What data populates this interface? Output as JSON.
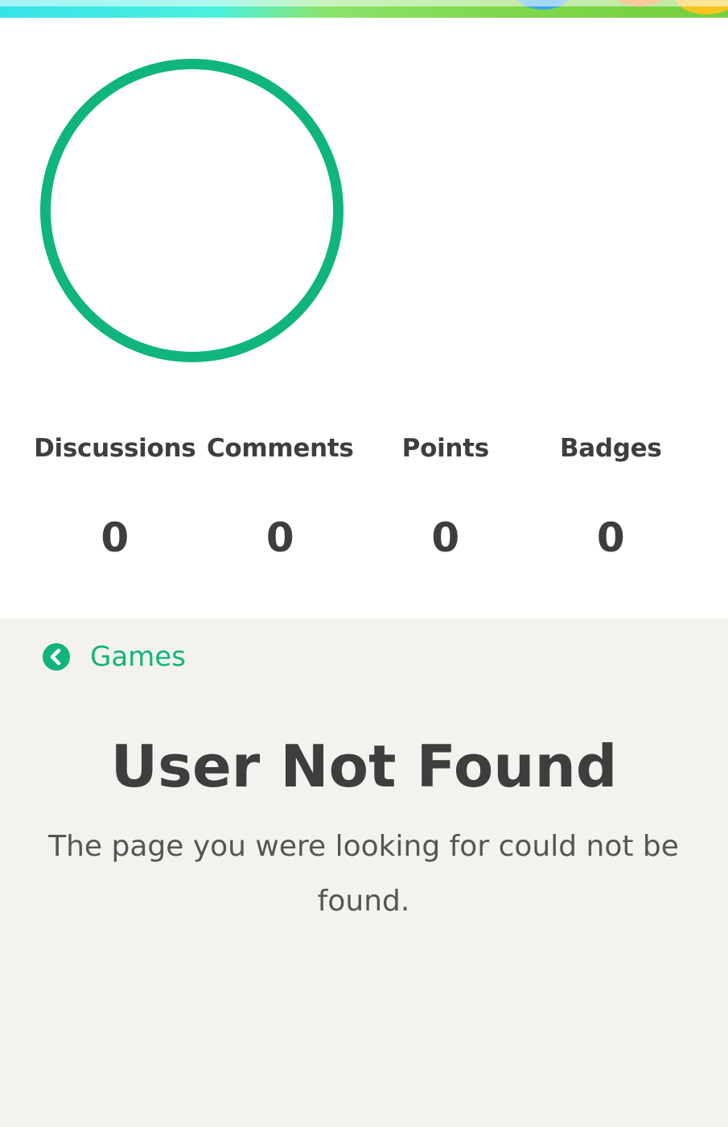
{
  "profile": {
    "stats": [
      {
        "label": "Discussions",
        "value": "0"
      },
      {
        "label": "Comments",
        "value": "0"
      },
      {
        "label": "Points",
        "value": "0"
      },
      {
        "label": "Badges",
        "value": "0"
      }
    ]
  },
  "breadcrumb": {
    "back_label": "Games",
    "icon": "chevron-left-circle-icon"
  },
  "main": {
    "title": "User Not Found",
    "message": "The page you were looking for could not be found."
  },
  "colors": {
    "accent": "#0fb57c",
    "text": "#3e3e3e",
    "content_background": "#f4f2ee"
  }
}
